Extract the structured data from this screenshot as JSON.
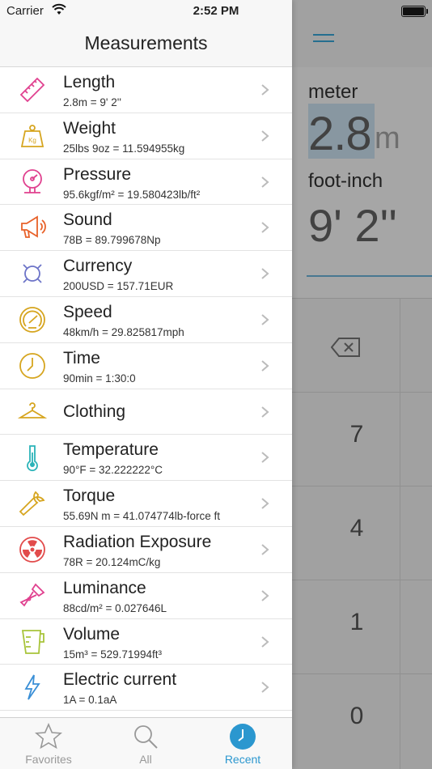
{
  "status": {
    "carrier": "Carrier",
    "time": "2:52 PM"
  },
  "drawer": {
    "title": "Measurements",
    "items": [
      {
        "name": "Length",
        "detail": "2.8m = 9' 2''",
        "icon": "ruler-icon",
        "color": "#e0418f"
      },
      {
        "name": "Weight",
        "detail": "25lbs 9oz = 11.594955kg",
        "icon": "weight-icon",
        "color": "#d6a51f"
      },
      {
        "name": "Pressure",
        "detail": "95.6kgf/m² = 19.580423lb/ft²",
        "icon": "pressure-gauge-icon",
        "color": "#e0418f"
      },
      {
        "name": "Sound",
        "detail": "78B = 89.799678Np",
        "icon": "megaphone-icon",
        "color": "#e8622a"
      },
      {
        "name": "Currency",
        "detail": "200USD = 157.71EUR",
        "icon": "currency-icon",
        "color": "#6d74c8"
      },
      {
        "name": "Speed",
        "detail": "48km/h = 29.825817mph",
        "icon": "speedometer-icon",
        "color": "#d6a51f"
      },
      {
        "name": "Time",
        "detail": "90min = 1:30:0",
        "icon": "clock-icon",
        "color": "#d6a51f"
      },
      {
        "name": "Clothing",
        "detail": "",
        "icon": "hanger-icon",
        "color": "#d6a51f"
      },
      {
        "name": "Temperature",
        "detail": "90°F = 32.222222°C",
        "icon": "thermometer-icon",
        "color": "#2ab3b8"
      },
      {
        "name": "Torque",
        "detail": "55.69N m = 41.074774lb-force ft",
        "icon": "wrench-icon",
        "color": "#d6a51f"
      },
      {
        "name": "Radiation Exposure",
        "detail": "78R = 20.124mC/kg",
        "icon": "radiation-icon",
        "color": "#e24b4b"
      },
      {
        "name": "Luminance",
        "detail": "88cd/m² = 0.027646L",
        "icon": "flashlight-icon",
        "color": "#e0418f"
      },
      {
        "name": "Volume",
        "detail": "15m³ = 529.71994ft³",
        "icon": "measuring-cup-icon",
        "color": "#a8c43a"
      },
      {
        "name": "Electric current",
        "detail": "1A = 0.1aA",
        "icon": "lightning-icon",
        "color": "#3a8fd6"
      }
    ]
  },
  "tabs": [
    {
      "label": "Favorites",
      "icon": "star-icon",
      "active": false
    },
    {
      "label": "All",
      "icon": "search-icon",
      "active": false
    },
    {
      "label": "Recent",
      "icon": "clock-icon",
      "active": true
    }
  ],
  "converter": {
    "unit_from": "meter",
    "value_from": "2.8",
    "value_from_unit": "m",
    "unit_to": "foot-inch",
    "value_to": "9' 2''",
    "keys": [
      "7",
      "4",
      "1",
      "0"
    ]
  },
  "colors": {
    "accent": "#2b97cf"
  }
}
